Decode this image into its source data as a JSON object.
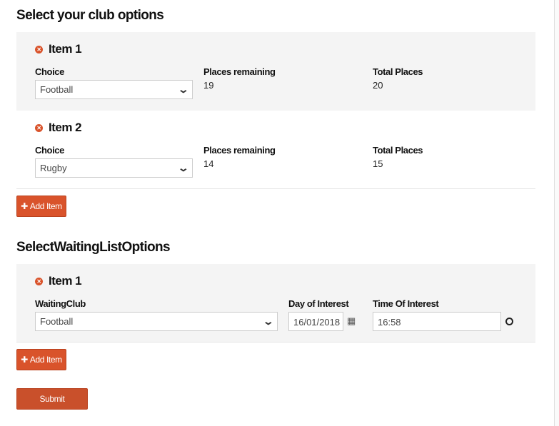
{
  "club": {
    "title": "Select your club options",
    "items": [
      {
        "title": "Item 1",
        "choice_label": "Choice",
        "choice": "Football",
        "remaining_label": "Places remaining",
        "remaining": "19",
        "total_label": "Total Places",
        "total": "20"
      },
      {
        "title": "Item 2",
        "choice_label": "Choice",
        "choice": "Rugby",
        "remaining_label": "Places remaining",
        "remaining": "14",
        "total_label": "Total Places",
        "total": "15"
      }
    ],
    "add_label": "Add Item"
  },
  "waiting": {
    "title": "SelectWaitingListOptions",
    "item": {
      "title": "Item 1",
      "club_label": "WaitingClub",
      "club": "Football",
      "day_label": "Day of Interest",
      "day": "16/01/2018",
      "time_label": "Time Of Interest",
      "time": "16:58"
    },
    "add_label": "Add Item"
  },
  "submit_label": "Submit",
  "colors": {
    "accent": "#d9532b",
    "panel": "#f4f4f4"
  }
}
